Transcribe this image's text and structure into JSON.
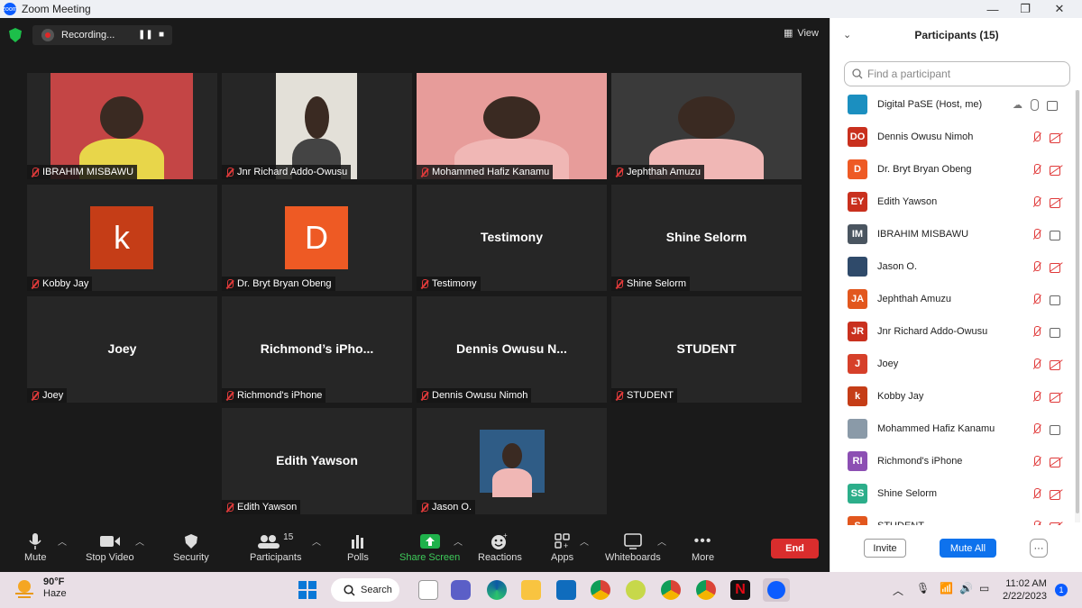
{
  "window": {
    "title": "Zoom Meeting",
    "minimize": "—",
    "maximize": "❐",
    "close": "✕"
  },
  "recording": {
    "label": "Recording..."
  },
  "view_label": "View",
  "tiles": [
    {
      "name": "IBRAHIM MISBAWU",
      "type": "video",
      "color": "#c44545"
    },
    {
      "name": "Jnr Richard Addo-Owusu",
      "type": "video",
      "color": "#e3e0d8"
    },
    {
      "name": "Mohammed Hafiz Kanamu",
      "type": "video",
      "color": "#e79c9a"
    },
    {
      "name": "Jephthah Amuzu",
      "type": "video",
      "color": "#3a3a3a"
    },
    {
      "name": "Kobby Jay",
      "type": "letter",
      "letter": "k",
      "color": "#c53d17"
    },
    {
      "name": "Dr. Bryt Bryan Obeng",
      "type": "letter",
      "letter": "D",
      "color": "#ee5a24"
    },
    {
      "name": "Testimony",
      "type": "text",
      "display": "Testimony"
    },
    {
      "name": "Shine Selorm",
      "type": "text",
      "display": "Shine Selorm"
    },
    {
      "name": "Joey",
      "type": "text",
      "display": "Joey"
    },
    {
      "name": "Richmond's iPhone",
      "type": "text",
      "display": "Richmond’s  iPho..."
    },
    {
      "name": "Dennis Owusu Nimoh",
      "type": "text",
      "display": "Dennis  Owusu  N..."
    },
    {
      "name": "STUDENT",
      "type": "text",
      "display": "STUDENT"
    },
    {
      "name": "Edith Yawson",
      "type": "text",
      "display": "Edith Yawson"
    },
    {
      "name": "Jason O.",
      "type": "video",
      "color": "#2f5c86"
    }
  ],
  "toolbar": {
    "mute": "Mute",
    "stop_video": "Stop Video",
    "security": "Security",
    "participants": "Participants",
    "participant_count": "15",
    "polls": "Polls",
    "share_screen": "Share Screen",
    "reactions": "Reactions",
    "apps": "Apps",
    "whiteboards": "Whiteboards",
    "more": "More",
    "end": "End"
  },
  "panel": {
    "title": "Participants (15)",
    "search_placeholder": "Find a participant",
    "participants": [
      {
        "initials": "",
        "name": "Digital PaSE (Host, me)",
        "color": "#1b8fc0",
        "host": true
      },
      {
        "initials": "DO",
        "name": "Dennis Owusu Nimoh",
        "color": "#c9301e",
        "video": false
      },
      {
        "initials": "D",
        "name": "Dr. Bryt Bryan Obeng",
        "color": "#ee5a24",
        "video": false
      },
      {
        "initials": "EY",
        "name": "Edith Yawson",
        "color": "#c9301e",
        "video": false
      },
      {
        "initials": "IM",
        "name": "IBRAHIM MISBAWU",
        "color": "#4a5560",
        "video": true
      },
      {
        "initials": "",
        "name": "Jason O.",
        "color": "#2f4a6a",
        "video": false
      },
      {
        "initials": "JA",
        "name": "Jephthah Amuzu",
        "color": "#e2571e",
        "video": true
      },
      {
        "initials": "JR",
        "name": "Jnr Richard Addo-Owusu",
        "color": "#c9301e",
        "video": true
      },
      {
        "initials": "J",
        "name": "Joey",
        "color": "#d6402a",
        "video": false
      },
      {
        "initials": "k",
        "name": "Kobby Jay",
        "color": "#c53d17",
        "video": false
      },
      {
        "initials": "",
        "name": "Mohammed Hafiz Kanamu",
        "color": "#8a9aa8",
        "video": true
      },
      {
        "initials": "RI",
        "name": "Richmond's iPhone",
        "color": "#8c4fb3",
        "video": false
      },
      {
        "initials": "SS",
        "name": "Shine Selorm",
        "color": "#2cae8a",
        "video": false
      },
      {
        "initials": "S",
        "name": "STUDENT",
        "color": "#e2571e",
        "video": false
      }
    ],
    "invite": "Invite",
    "mute_all": "Mute All",
    "more": "···"
  },
  "taskbar": {
    "temp": "90°F",
    "weather": "Haze",
    "search": "Search",
    "time": "11:02 AM",
    "date": "2/22/2023",
    "notif_count": "1"
  }
}
